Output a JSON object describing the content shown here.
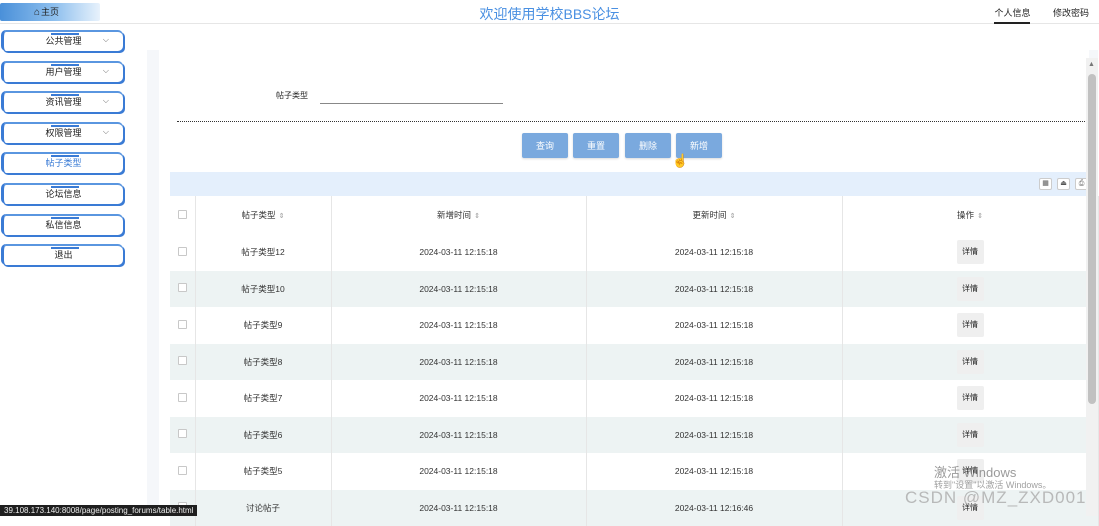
{
  "topbar": {
    "home_label": "主页",
    "title": "欢迎使用学校BBS论坛",
    "links": [
      "个人信息",
      "修改密码"
    ]
  },
  "sidebar": {
    "items": [
      {
        "label": "公共管理",
        "has_arrow": true
      },
      {
        "label": "用户管理",
        "has_arrow": true
      },
      {
        "label": "资讯管理",
        "has_arrow": true
      },
      {
        "label": "权限管理",
        "has_arrow": true
      },
      {
        "label": "帖子类型",
        "has_arrow": false
      },
      {
        "label": "论坛信息",
        "has_arrow": false
      },
      {
        "label": "私信信息",
        "has_arrow": false
      },
      {
        "label": "退出",
        "has_arrow": false
      }
    ]
  },
  "search": {
    "label": "帖子类型",
    "value": ""
  },
  "buttons": {
    "query": "查询",
    "reset": "重置",
    "delete": "删除",
    "add": "新增"
  },
  "table": {
    "headers": [
      "帖子类型",
      "新增时间",
      "更新时间",
      "操作"
    ],
    "detail_label": "详情",
    "rows": [
      {
        "type": "帖子类型12",
        "created": "2024-03-11 12:15:18",
        "updated": "2024-03-11 12:15:18"
      },
      {
        "type": "帖子类型10",
        "created": "2024-03-11 12:15:18",
        "updated": "2024-03-11 12:15:18"
      },
      {
        "type": "帖子类型9",
        "created": "2024-03-11 12:15:18",
        "updated": "2024-03-11 12:15:18"
      },
      {
        "type": "帖子类型8",
        "created": "2024-03-11 12:15:18",
        "updated": "2024-03-11 12:15:18"
      },
      {
        "type": "帖子类型7",
        "created": "2024-03-11 12:15:18",
        "updated": "2024-03-11 12:15:18"
      },
      {
        "type": "帖子类型6",
        "created": "2024-03-11 12:15:18",
        "updated": "2024-03-11 12:15:18"
      },
      {
        "type": "帖子类型5",
        "created": "2024-03-11 12:15:18",
        "updated": "2024-03-11 12:15:18"
      },
      {
        "type": "讨论帖子",
        "created": "2024-03-11 12:15:18",
        "updated": "2024-03-11 12:16:46"
      }
    ]
  },
  "statusbar": {
    "url": "39.108.173.140:8008/page/posting_forums/table.html"
  },
  "watermark": {
    "windows_line1": "激活 Windows",
    "windows_line2": "转到\"设置\"以激活 Windows。",
    "csdn": "CSDN @MZ_ZXD001"
  },
  "colors": {
    "accent": "#3a7bd5",
    "button": "#7aa9de",
    "title": "#4a90e2",
    "toolbar": "#e4effc",
    "row_alt": "#edf3f3"
  }
}
